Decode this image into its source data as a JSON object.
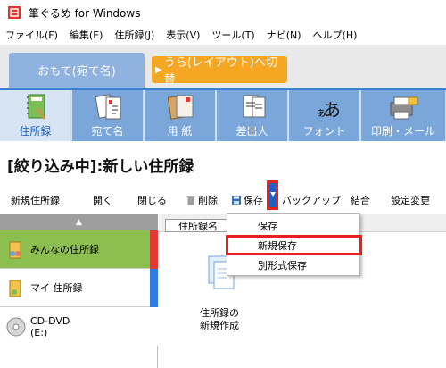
{
  "window": {
    "title": "筆ぐるめ for Windows"
  },
  "menubar": [
    "ファイル(F)",
    "編集(E)",
    "住所録(J)",
    "表示(V)",
    "ツール(T)",
    "ナビ(N)",
    "ヘルプ(H)"
  ],
  "tabs": {
    "front": "おもて(宛て名)",
    "back": "うら(レイアウト)へ切替",
    "back_arrow": "▶"
  },
  "ribbon": [
    {
      "label": "住所録",
      "icon": "address-book-icon",
      "active": true
    },
    {
      "label": "宛て名",
      "icon": "recipient-card-icon",
      "active": false
    },
    {
      "label": "用 紙",
      "icon": "paper-icon",
      "active": false
    },
    {
      "label": "差出人",
      "icon": "sender-card-icon",
      "active": false
    },
    {
      "label": "フォント",
      "icon": "font-icon",
      "active": false
    },
    {
      "label": "印刷・メール",
      "icon": "printer-icon",
      "active": false
    }
  ],
  "page_title": "[絞り込み中]:新しい住所録",
  "toolbar": {
    "new": "新規住所録",
    "open": "開く",
    "close": "閉じる",
    "delete": "削除",
    "save": "保存",
    "backup": "バックアップ",
    "merge": "結合",
    "settings": "設定変更"
  },
  "sidebar": {
    "scroll_up": "▲",
    "items": [
      {
        "label": "みんなの住所録",
        "icon": "shared-addressbook-icon",
        "stripe": "#e53935",
        "bg": "#8cbf4f"
      },
      {
        "label": "マイ 住所録",
        "icon": "my-addressbook-icon",
        "stripe": "#2f7de1",
        "bg": "#ffffff"
      },
      {
        "label": "CD-DVD\n(E:)",
        "icon": "disc-icon",
        "stripe": "#ffffff",
        "bg": "#ffffff"
      }
    ]
  },
  "content": {
    "column_header": "住所録名",
    "new_label_line1": "住所録の",
    "new_label_line2": "新規作成"
  },
  "dropdown": [
    "保存",
    "新規保存",
    "別形式保存"
  ]
}
